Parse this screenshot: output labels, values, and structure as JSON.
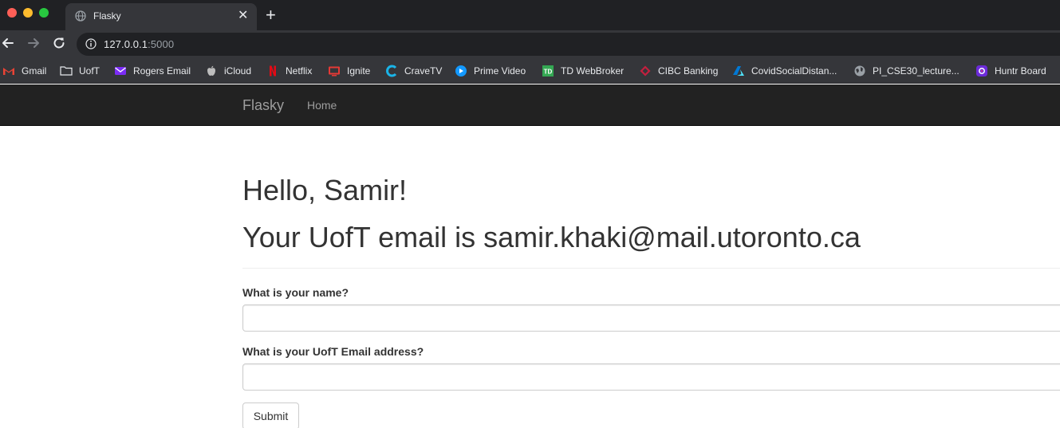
{
  "browser": {
    "tab_title": "Flasky",
    "tab_close": "✕",
    "new_tab": "+",
    "url_host": "127.0.0.1",
    "url_port": ":5000"
  },
  "bookmarks": [
    {
      "label": "Gmail",
      "icon": "gmail-icon",
      "color": "#ea4335"
    },
    {
      "label": "UofT",
      "icon": "folder-icon",
      "color": "#e8eaed"
    },
    {
      "label": "Rogers Email",
      "icon": "yahoo-mail-icon",
      "color": "#7b2cf5"
    },
    {
      "label": "iCloud",
      "icon": "apple-icon",
      "color": "#bdbdbd"
    },
    {
      "label": "Netflix",
      "icon": "netflix-icon",
      "color": "#e50914"
    },
    {
      "label": "Ignite",
      "icon": "ignite-icon",
      "color": "#e53935"
    },
    {
      "label": "CraveTV",
      "icon": "crave-icon",
      "color": "#1ab4e8"
    },
    {
      "label": "Prime Video",
      "icon": "prime-video-icon",
      "color": "#1399ff"
    },
    {
      "label": "TD WebBroker",
      "icon": "td-icon",
      "color": "#34a853"
    },
    {
      "label": "CIBC Banking",
      "icon": "cibc-icon",
      "color": "#c41f3e"
    },
    {
      "label": "CovidSocialDistan...",
      "icon": "azure-icon",
      "color": "#0078d4"
    },
    {
      "label": "PI_CSE30_lecture...",
      "icon": "globe-icon",
      "color": "#9aa0a6"
    },
    {
      "label": "Huntr Board",
      "icon": "huntr-icon",
      "color": "#6c2bd9"
    }
  ],
  "navbar": {
    "brand": "Flasky",
    "home": "Home"
  },
  "main": {
    "greeting": "Hello, Samir!",
    "email_line": "Your UofT email is samir.khaki@mail.utoronto.ca",
    "name_label": "What is your name?",
    "name_value": "",
    "email_label": "What is your UofT Email address?",
    "email_value": "",
    "submit_label": "Submit"
  }
}
